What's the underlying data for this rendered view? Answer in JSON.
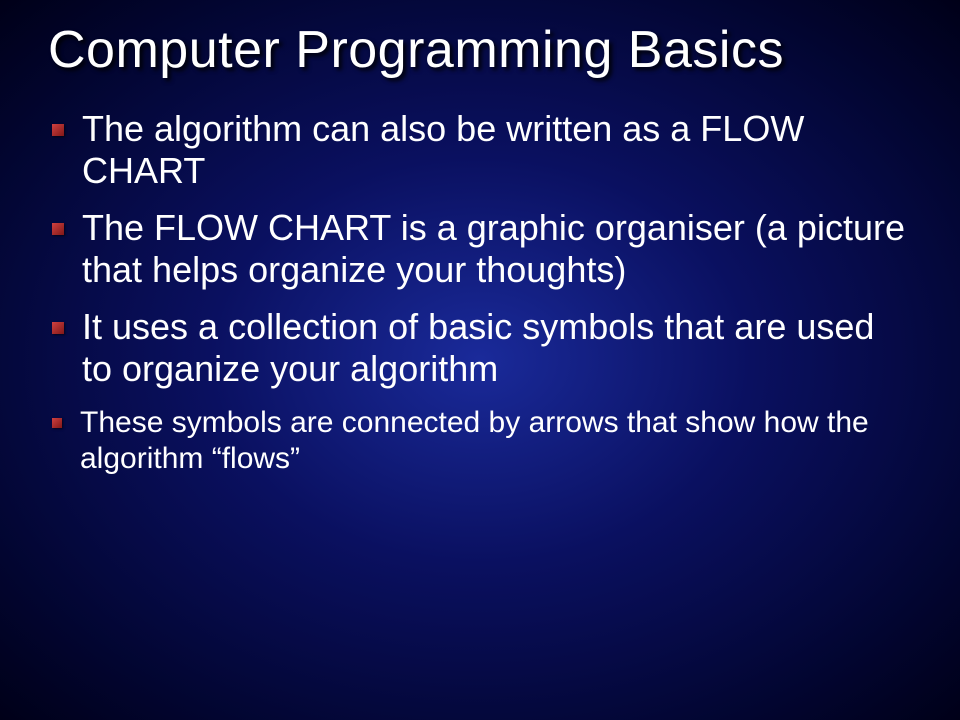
{
  "slide": {
    "title": "Computer Programming Basics",
    "bullets": [
      {
        "text": "The algorithm can also be written as a FLOW CHART",
        "size": "normal"
      },
      {
        "text": "The FLOW CHART is a graphic organiser (a picture that helps organize your thoughts)",
        "size": "normal"
      },
      {
        "text": "It uses a collection of basic symbols that are used to organize your algorithm",
        "size": "normal"
      },
      {
        "text": "These symbols are connected by arrows that show how the algorithm “flows”",
        "size": "smaller"
      }
    ]
  }
}
